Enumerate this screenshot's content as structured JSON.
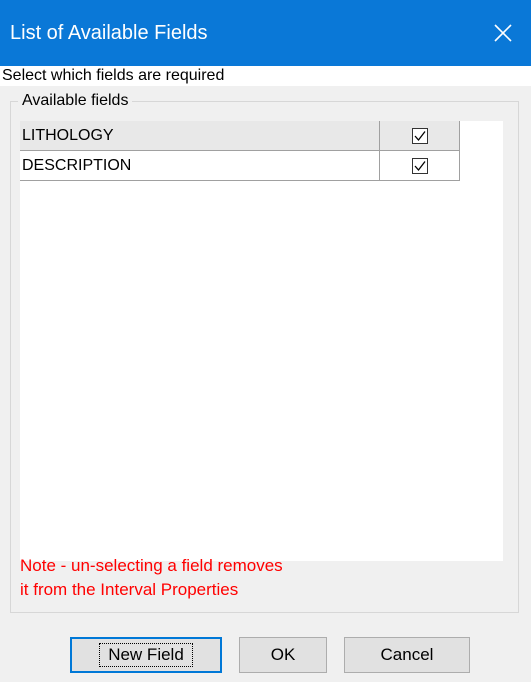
{
  "window": {
    "title": "List of Available Fields",
    "close_icon": "close-icon",
    "accent_color": "#0a78d7"
  },
  "instruction": "Select which fields are required",
  "group": {
    "legend": "Available fields",
    "fields": [
      {
        "name": "LITHOLOGY",
        "checked": true
      },
      {
        "name": "DESCRIPTION",
        "checked": true
      }
    ]
  },
  "note": {
    "line1": "Note - un-selecting a field removes",
    "line2": "it from the Interval Properties",
    "color": "#ff0000"
  },
  "buttons": {
    "new_field": "New Field",
    "ok": "OK",
    "cancel": "Cancel"
  }
}
